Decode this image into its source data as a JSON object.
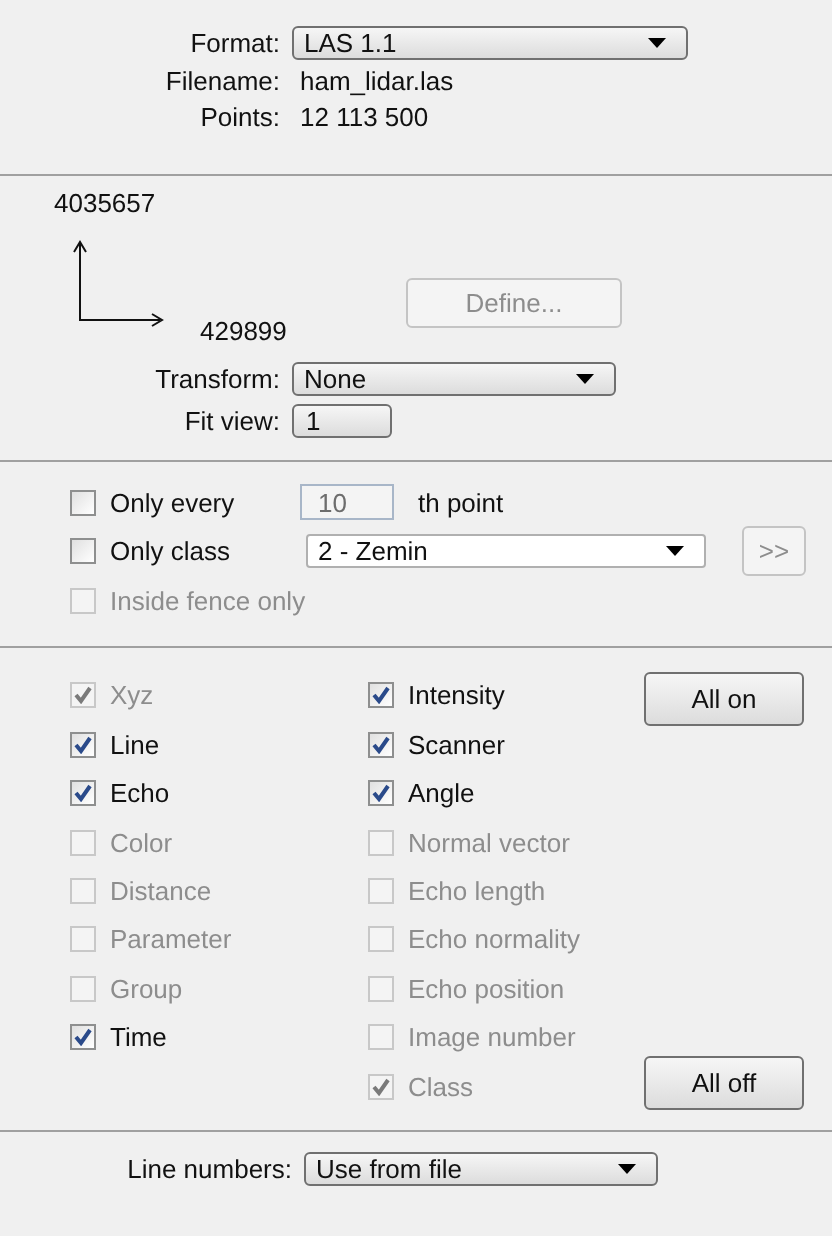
{
  "file_info": [
    {
      "kind": "select",
      "label": "Format:",
      "value": "LAS 1.1"
    },
    {
      "kind": "text",
      "label": "Filename:",
      "value": "ham_lidar.las"
    },
    {
      "kind": "text",
      "label": "Points:",
      "value": "12 113 500"
    }
  ],
  "coordinates": {
    "y_value": "4035657",
    "x_value": "429899",
    "define_button": {
      "label": "Define...",
      "disabled": true
    },
    "transform": {
      "label": "Transform:",
      "value": "None"
    },
    "fit_view": {
      "label": "Fit view:",
      "value": "1"
    }
  },
  "filters": {
    "only_every": {
      "label": "Only every",
      "checked": false,
      "value": "10",
      "suffix": "th point"
    },
    "only_class": {
      "label": "Only class",
      "checked": false,
      "value": "2 - Zemin",
      "more_button": ">>"
    },
    "inside_fence": {
      "label": "Inside fence only",
      "checked": false,
      "disabled": true
    }
  },
  "attributes": {
    "column_1": [
      {
        "label": "Xyz",
        "checked": true,
        "disabled": true
      },
      {
        "label": "Line",
        "checked": true,
        "disabled": false
      },
      {
        "label": "Echo",
        "checked": true,
        "disabled": false
      },
      {
        "label": "Color",
        "checked": false,
        "disabled": true
      },
      {
        "label": "Distance",
        "checked": false,
        "disabled": true
      },
      {
        "label": "Parameter",
        "checked": false,
        "disabled": true
      },
      {
        "label": "Group",
        "checked": false,
        "disabled": true
      },
      {
        "label": "Time",
        "checked": true,
        "disabled": false
      }
    ],
    "column_2": [
      {
        "label": "Intensity",
        "checked": true,
        "disabled": false
      },
      {
        "label": "Scanner",
        "checked": true,
        "disabled": false
      },
      {
        "label": "Angle",
        "checked": true,
        "disabled": false
      },
      {
        "label": "Normal vector",
        "checked": false,
        "disabled": true
      },
      {
        "label": "Echo length",
        "checked": false,
        "disabled": true
      },
      {
        "label": "Echo normality",
        "checked": false,
        "disabled": true
      },
      {
        "label": "Echo position",
        "checked": false,
        "disabled": true
      },
      {
        "label": "Image number",
        "checked": false,
        "disabled": true
      },
      {
        "label": "Class",
        "checked": true,
        "disabled": true
      }
    ],
    "all_on_button": "All on",
    "all_off_button": "All off"
  },
  "line_numbers": {
    "label": "Line numbers:",
    "value": "Use from file"
  }
}
